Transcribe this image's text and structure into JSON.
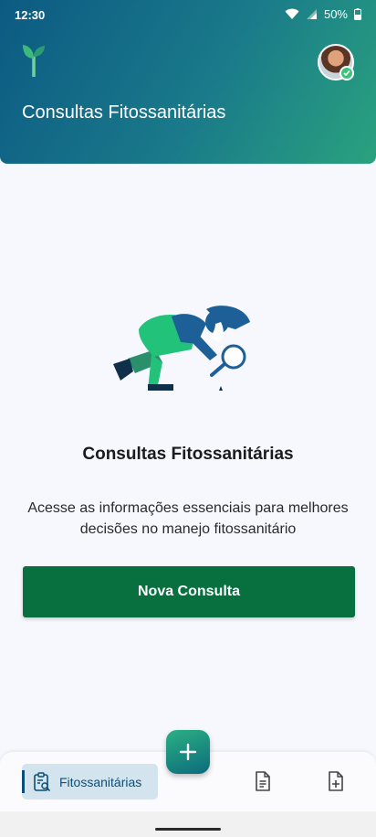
{
  "status_bar": {
    "time": "12:30",
    "battery": "50%"
  },
  "header": {
    "logo_icon": "sprout-icon",
    "title": "Consultas Fitossanitárias",
    "avatar_status": "online-check-icon"
  },
  "empty_state": {
    "illustration": "person-with-magnifying-glass",
    "title": "Consultas Fitossanitárias",
    "description": "Acesse as informações essenciais para melhores decisões no manejo fitossanitário",
    "button_label": "Nova Consulta"
  },
  "bottom_nav": {
    "items": [
      {
        "label": "Fitossanitárias",
        "icon": "clipboard-search-icon",
        "active": true
      },
      {
        "label": "",
        "icon": "document-icon",
        "active": false
      },
      {
        "label": "",
        "icon": "document-add-icon",
        "active": false
      }
    ],
    "fab_icon": "plus-icon"
  },
  "colors": {
    "header_gradient_start": "#0c5a83",
    "header_gradient_end": "#2aa27e",
    "primary_button": "#08703e",
    "nav_active_bg": "#d3e4ee",
    "nav_active_text": "#0a4f77"
  }
}
